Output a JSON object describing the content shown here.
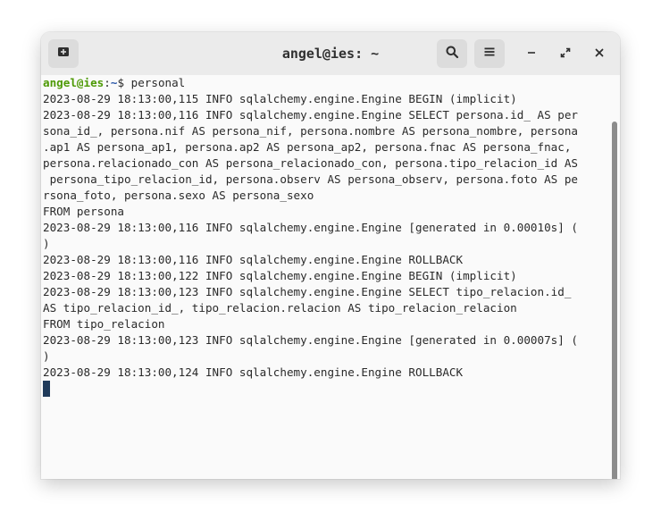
{
  "window": {
    "title": "angel@ies: ~"
  },
  "icons": {
    "new_tab": "new-tab-icon",
    "search": "search-icon",
    "menu": "hamburger-menu-icon",
    "minimize": "minimize-icon",
    "maximize": "maximize-icon",
    "close": "close-icon"
  },
  "prompt": {
    "user_host": "angel@ies",
    "separator": ":",
    "path": "~",
    "symbol": "$ ",
    "command": "personal"
  },
  "output_lines": [
    "2023-08-29 18:13:00,115 INFO sqlalchemy.engine.Engine BEGIN (implicit)",
    "2023-08-29 18:13:00,116 INFO sqlalchemy.engine.Engine SELECT persona.id_ AS per",
    "sona_id_, persona.nif AS persona_nif, persona.nombre AS persona_nombre, persona",
    ".ap1 AS persona_ap1, persona.ap2 AS persona_ap2, persona.fnac AS persona_fnac,",
    "persona.relacionado_con AS persona_relacionado_con, persona.tipo_relacion_id AS",
    " persona_tipo_relacion_id, persona.observ AS persona_observ, persona.foto AS pe",
    "rsona_foto, persona.sexo AS persona_sexo",
    "FROM persona",
    "2023-08-29 18:13:00,116 INFO sqlalchemy.engine.Engine [generated in 0.00010s] (",
    ")",
    "2023-08-29 18:13:00,116 INFO sqlalchemy.engine.Engine ROLLBACK",
    "2023-08-29 18:13:00,122 INFO sqlalchemy.engine.Engine BEGIN (implicit)",
    "2023-08-29 18:13:00,123 INFO sqlalchemy.engine.Engine SELECT tipo_relacion.id_",
    "AS tipo_relacion_id_, tipo_relacion.relacion AS tipo_relacion_relacion",
    "FROM tipo_relacion",
    "2023-08-29 18:13:00,123 INFO sqlalchemy.engine.Engine [generated in 0.00007s] (",
    ")",
    "2023-08-29 18:13:00,124 INFO sqlalchemy.engine.Engine ROLLBACK"
  ]
}
